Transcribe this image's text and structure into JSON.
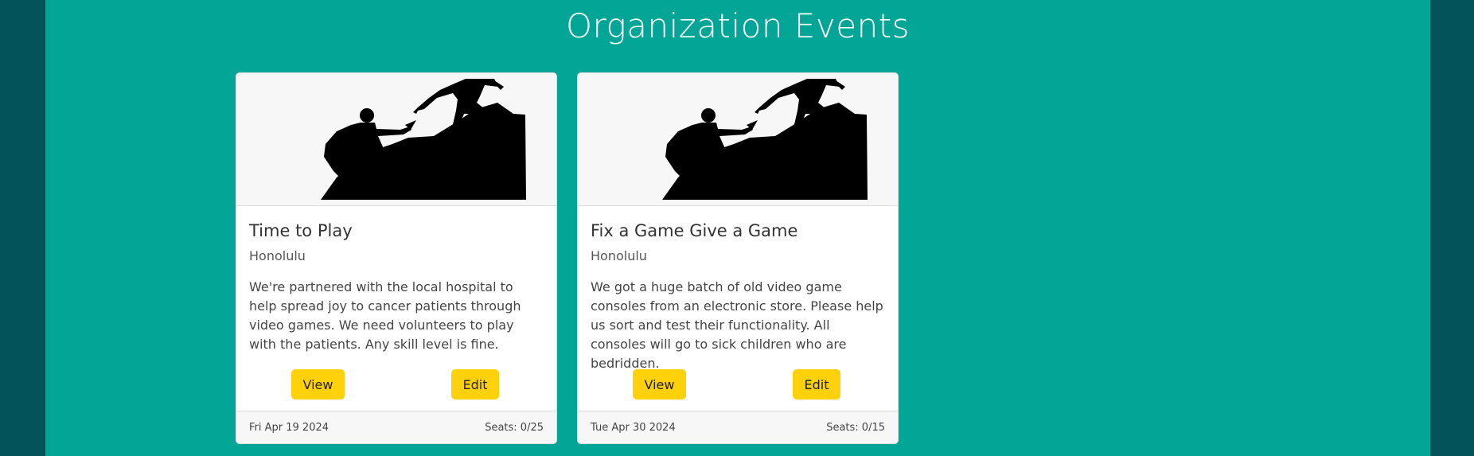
{
  "page": {
    "title": "Organization Events"
  },
  "events": [
    {
      "title": "Time to Play",
      "location": "Honolulu",
      "description": "We're partnered with the local hospital to help spread joy to cancer patients through video games. We need volunteers to play with the patients. Any skill level is fine.",
      "view_label": "View",
      "edit_label": "Edit",
      "date": "Fri Apr 19 2024",
      "seats": "Seats: 0/25",
      "image_icon": "helping-hand-climbers-image"
    },
    {
      "title": "Fix a Game Give a Game",
      "location": "Honolulu",
      "description": "We got a huge batch of old video game consoles from an electronic store. Please help us sort and test their functionality. All consoles will go to sick children who are bedridden.",
      "view_label": "View",
      "edit_label": "Edit",
      "date": "Tue Apr 30 2024",
      "seats": "Seats: 0/15",
      "image_icon": "helping-hand-climbers-image"
    }
  ],
  "colors": {
    "outer_background": "#02545a",
    "main_background": "#03a696",
    "button": "#ffd10a",
    "card_background": "#ffffff"
  }
}
